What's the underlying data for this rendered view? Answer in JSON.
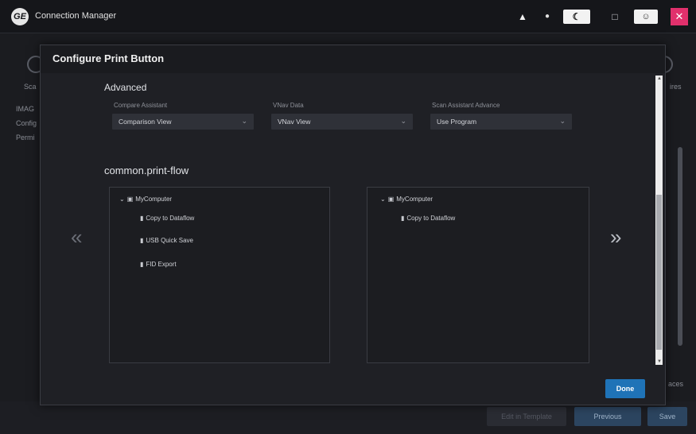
{
  "app": {
    "title": "Connection Manager",
    "logo": "GE"
  },
  "titlebar": {
    "bell_icon": "bell-icon",
    "sun_icon": "sun-icon",
    "moon_icon": "moon-icon",
    "monitor_icon": "monitor-icon",
    "user_icon": "user-icon",
    "close_icon": "close-icon"
  },
  "background": {
    "left_labels": [
      "Sca",
      "IMAG",
      "Config",
      "Permi"
    ],
    "right_label": "ires",
    "bottom_right_label": "aces",
    "bottom_buttons": {
      "disabled": "Edit in Template",
      "previous": "Previous",
      "save": "Save"
    }
  },
  "modal": {
    "title": "Configure Print Button",
    "advanced": {
      "title": "Advanced",
      "fields": [
        {
          "label": "Compare Assistant",
          "value": "Comparison View"
        },
        {
          "label": "VNav Data",
          "value": "VNav View"
        },
        {
          "label": "Scan Assistant Advance",
          "value": "Use Program"
        }
      ]
    },
    "print_flow": {
      "title": "common.print-flow",
      "left_tree": {
        "root": "MyComputer",
        "children": [
          "Copy to Dataflow",
          "USB Quick Save",
          "FID Export"
        ]
      },
      "right_tree": {
        "root": "MyComputer",
        "children": [
          "Copy to Dataflow"
        ]
      }
    },
    "prev_arrow": "«",
    "next_arrow": "»",
    "done_label": "Done"
  }
}
